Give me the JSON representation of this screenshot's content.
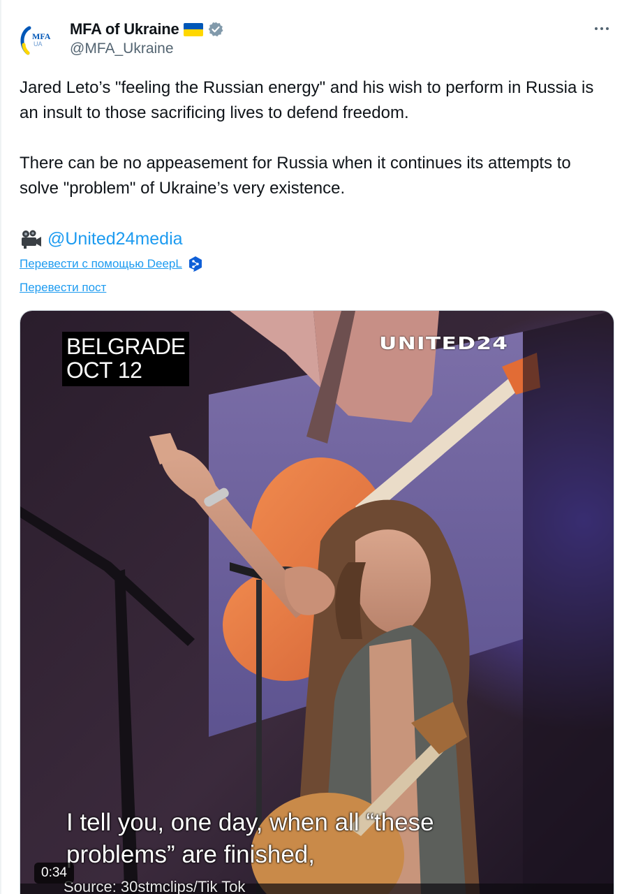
{
  "account": {
    "display_name": "MFA of Ukraine",
    "handle": "@MFA_Ukraine",
    "avatar_text_top": "MFA",
    "avatar_text_bottom": "UA"
  },
  "icons": {
    "avatar": "mfa-ukraine-logo",
    "flag": "ukraine-flag-icon",
    "verified": "verified-badge-icon",
    "more": "more-options-icon",
    "camera": "movie-camera-icon",
    "deepl": "deepl-icon"
  },
  "tweet": {
    "paragraph_1": "Jared Leto’s \"feeling the Russian energy\" and his wish to perform in Russia is an insult to those sacrificing lives to defend freedom.",
    "paragraph_2": "There can be no appeasement for Russia when it continues its attempts to solve \"problem\" of Ukraine’s very existence.",
    "mention": "@United24media"
  },
  "translate": {
    "deepl_label": "Перевести с помощью DeepL",
    "post_label": "Перевести пост"
  },
  "media": {
    "location_line_1": "BELGRADE",
    "location_line_2": "OCT 12",
    "brand": "UNITED24",
    "subtitle_line_1": "I tell you, one day, when all “these",
    "subtitle_line_2": "problems” are finished,",
    "source": "Source: 30stmclips/Tik Tok",
    "duration": "0:34"
  },
  "colors": {
    "link": "#1d9bf0",
    "text": "#0f1419",
    "secondary": "#536471",
    "flag_blue": "#0057b7",
    "flag_yellow": "#ffd700",
    "verified": "#829aab"
  }
}
